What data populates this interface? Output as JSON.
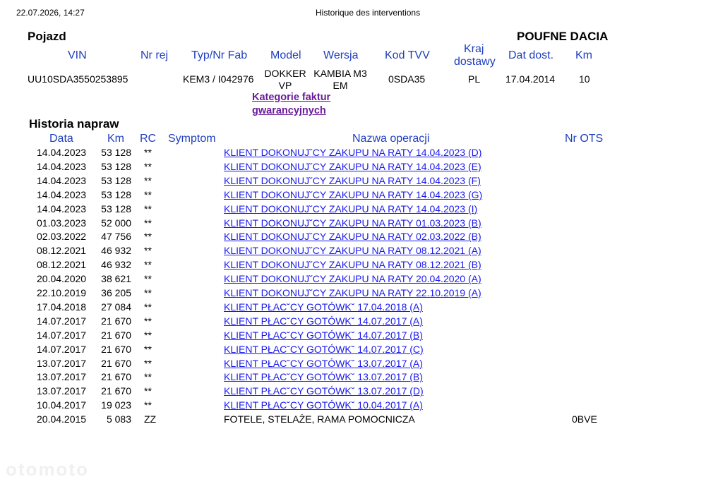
{
  "header": {
    "timestamp": "22.07.2026, 14:27",
    "title": "Historique des interventions"
  },
  "vehicle": {
    "section_title": "Pojazd",
    "confidential": "POUFNE DACIA",
    "columns": {
      "vin": "VIN",
      "nr_rej": "Nr rej",
      "typ": "Typ/Nr Fab",
      "model": "Model",
      "wersja": "Wersja",
      "kod_tvv": "Kod TVV",
      "kraj_line1": "Kraj",
      "kraj_line2": "dostawy",
      "dat_dost": "Dat dost.",
      "km": "Km"
    },
    "values": {
      "vin": "UU10SDA3550253895",
      "nr_rej": "",
      "typ": "KEM3 / I042976",
      "model_line1": "DOKKER",
      "model_line2": "VP",
      "wersja_line1": "KAMBIA M3",
      "wersja_line2": "EM",
      "kod_tvv": "0SDA35",
      "kraj": "PL",
      "dat_dost": "17.04.2014",
      "km": "10"
    },
    "category_link_line1": "Kategorie faktur",
    "category_link_line2": "gwarancyjnych"
  },
  "history": {
    "section_title": "Historia napraw",
    "columns": {
      "data": "Data",
      "km": "Km",
      "rc": "RC",
      "symptom": "Symptom",
      "operation": "Nazwa operacji",
      "ots": "Nr OTS"
    },
    "rows": [
      {
        "date": "14.04.2023",
        "km": "53 128",
        "rc": "**",
        "symptom": "",
        "operation": "KLIENT DOKONUJ˘CY ZAKUPU NA RATY 14.04.2023 (D)",
        "link": true,
        "ots": ""
      },
      {
        "date": "14.04.2023",
        "km": "53 128",
        "rc": "**",
        "symptom": "",
        "operation": "KLIENT DOKONUJ˘CY ZAKUPU NA RATY 14.04.2023 (E)",
        "link": true,
        "ots": ""
      },
      {
        "date": "14.04.2023",
        "km": "53 128",
        "rc": "**",
        "symptom": "",
        "operation": "KLIENT DOKONUJ˘CY ZAKUPU NA RATY 14.04.2023 (F)",
        "link": true,
        "ots": ""
      },
      {
        "date": "14.04.2023",
        "km": "53 128",
        "rc": "**",
        "symptom": "",
        "operation": "KLIENT DOKONUJ˘CY ZAKUPU NA RATY 14.04.2023 (G)",
        "link": true,
        "ots": ""
      },
      {
        "date": "14.04.2023",
        "km": "53 128",
        "rc": "**",
        "symptom": "",
        "operation": "KLIENT DOKONUJ˘CY ZAKUPU NA RATY 14.04.2023 (I)",
        "link": true,
        "ots": ""
      },
      {
        "date": "01.03.2023",
        "km": "52 000",
        "rc": "**",
        "symptom": "",
        "operation": "KLIENT DOKONUJ˘CY ZAKUPU NA RATY 01.03.2023 (B)",
        "link": true,
        "ots": ""
      },
      {
        "date": "02.03.2022",
        "km": "47 756",
        "rc": "**",
        "symptom": "",
        "operation": "KLIENT DOKONUJ˘CY ZAKUPU NA RATY 02.03.2022 (B)",
        "link": true,
        "ots": ""
      },
      {
        "date": "08.12.2021",
        "km": "46 932",
        "rc": "**",
        "symptom": "",
        "operation": "KLIENT DOKONUJ˘CY ZAKUPU NA RATY 08.12.2021 (A)",
        "link": true,
        "ots": ""
      },
      {
        "date": "08.12.2021",
        "km": "46 932",
        "rc": "**",
        "symptom": "",
        "operation": "KLIENT DOKONUJ˘CY ZAKUPU NA RATY 08.12.2021 (B)",
        "link": true,
        "ots": ""
      },
      {
        "date": "20.04.2020",
        "km": "38 621",
        "rc": "**",
        "symptom": "",
        "operation": "KLIENT DOKONUJ˘CY ZAKUPU NA RATY 20.04.2020 (A)",
        "link": true,
        "ots": ""
      },
      {
        "date": "22.10.2019",
        "km": "36 205",
        "rc": "**",
        "symptom": "",
        "operation": "KLIENT DOKONUJ˘CY ZAKUPU NA RATY 22.10.2019 (A)",
        "link": true,
        "ots": ""
      },
      {
        "date": "17.04.2018",
        "km": "27 084",
        "rc": "**",
        "symptom": "",
        "operation": "KLIENT PŁAC˘CY GOTÓWK˘ 17.04.2018 (A)",
        "link": true,
        "ots": ""
      },
      {
        "date": "14.07.2017",
        "km": "21 670",
        "rc": "**",
        "symptom": "",
        "operation": "KLIENT PŁAC˘CY GOTÓWK˘ 14.07.2017 (A)",
        "link": true,
        "ots": ""
      },
      {
        "date": "14.07.2017",
        "km": "21 670",
        "rc": "**",
        "symptom": "",
        "operation": "KLIENT PŁAC˘CY GOTÓWK˘ 14.07.2017 (B)",
        "link": true,
        "ots": ""
      },
      {
        "date": "14.07.2017",
        "km": "21 670",
        "rc": "**",
        "symptom": "",
        "operation": "KLIENT PŁAC˘CY GOTÓWK˘ 14.07.2017 (C)",
        "link": true,
        "ots": ""
      },
      {
        "date": "13.07.2017",
        "km": "21 670",
        "rc": "**",
        "symptom": "",
        "operation": "KLIENT PŁAC˘CY GOTÓWK˘ 13.07.2017 (A)",
        "link": true,
        "ots": ""
      },
      {
        "date": "13.07.2017",
        "km": "21 670",
        "rc": "**",
        "symptom": "",
        "operation": "KLIENT PŁAC˘CY GOTÓWK˘ 13.07.2017 (B)",
        "link": true,
        "ots": ""
      },
      {
        "date": "13.07.2017",
        "km": "21 670",
        "rc": "**",
        "symptom": "",
        "operation": "KLIENT PŁAC˘CY GOTÓWK˘ 13.07.2017 (D)",
        "link": true,
        "ots": ""
      },
      {
        "date": "10.04.2017",
        "km": "19 023",
        "rc": "**",
        "symptom": "",
        "operation": "KLIENT PŁAC˘CY GOTÓWK˘ 10.04.2017 (A)",
        "link": true,
        "ots": ""
      },
      {
        "date": "20.04.2015",
        "km": "5 083",
        "rc": "ZZ",
        "symptom": "",
        "operation": "FOTELE, STELAŻE, RAMA POMOCNICZA",
        "link": false,
        "ots": "0BVE"
      }
    ]
  },
  "watermark": "otomoto"
}
